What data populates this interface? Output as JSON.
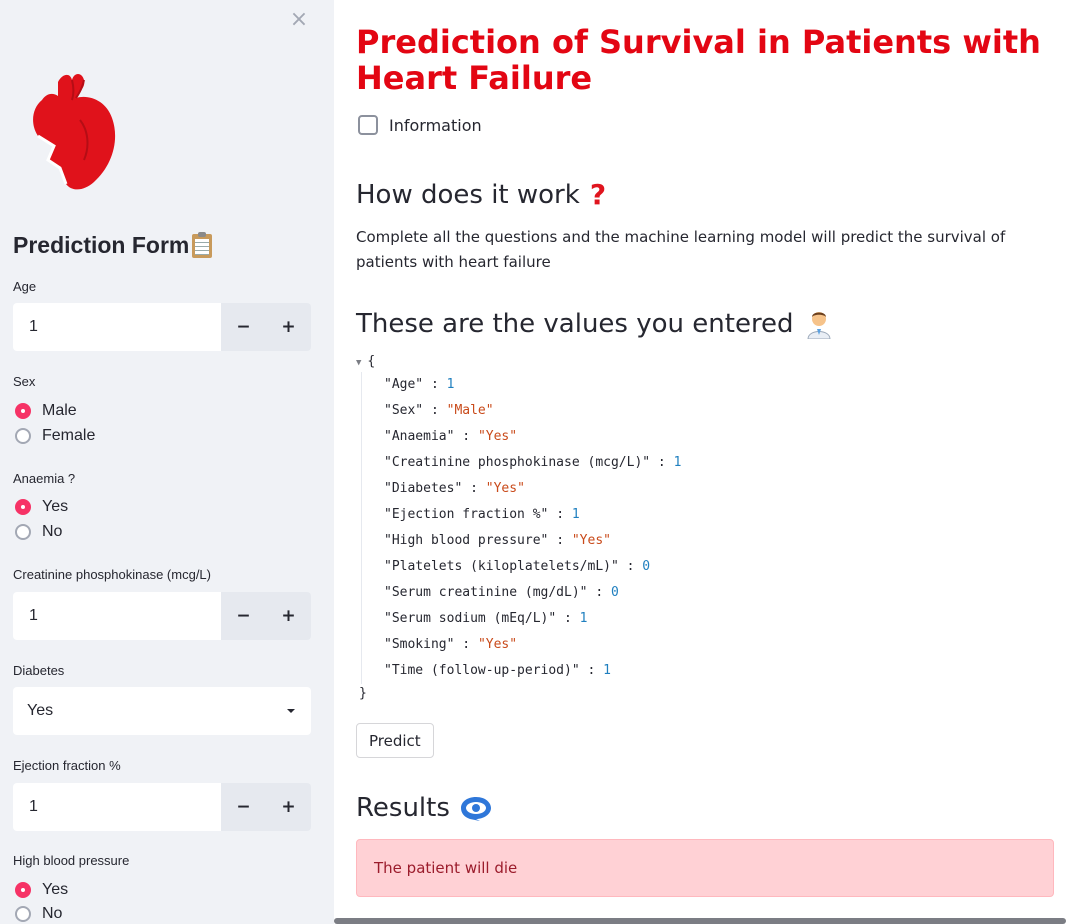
{
  "sidebar": {
    "close_glyph": "×",
    "logo_icon": "broken-heart-icon",
    "form_title": "Prediction Form",
    "age": {
      "label": "Age",
      "value": "1",
      "minus": "−",
      "plus": "+"
    },
    "sex": {
      "label": "Sex",
      "options": [
        "Male",
        "Female"
      ],
      "selected": "Male"
    },
    "anaemia": {
      "label": "Anaemia ?",
      "options": [
        "Yes",
        "No"
      ],
      "selected": "Yes"
    },
    "cpk": {
      "label": "Creatinine phosphokinase (mcg/L)",
      "value": "1",
      "minus": "−",
      "plus": "+"
    },
    "diabetes": {
      "label": "Diabetes",
      "selected": "Yes"
    },
    "ejection": {
      "label": "Ejection fraction %",
      "value": "1",
      "minus": "−",
      "plus": "+"
    },
    "hbp": {
      "label": "High blood pressure",
      "options": [
        "Yes",
        "No"
      ],
      "selected": "Yes"
    }
  },
  "main": {
    "title": "Prediction of Survival in Patients with Heart Failure",
    "info_checkbox_label": "Information",
    "how_heading": "How does it work",
    "how_text": "Complete all the questions and the machine learning model will predict the survival of patients with heart failure",
    "values_heading": "These are the values you entered",
    "json_open": "{",
    "json_close": "}",
    "entries": [
      {
        "key": "\"Age\"",
        "val": "1",
        "type": "num"
      },
      {
        "key": "\"Sex\"",
        "val": "\"Male\"",
        "type": "str"
      },
      {
        "key": "\"Anaemia\"",
        "val": "\"Yes\"",
        "type": "str"
      },
      {
        "key": "\"Creatinine phosphokinase (mcg/L)\"",
        "val": "1",
        "type": "num"
      },
      {
        "key": "\"Diabetes\"",
        "val": "\"Yes\"",
        "type": "str"
      },
      {
        "key": "\"Ejection fraction %\"",
        "val": "1",
        "type": "num"
      },
      {
        "key": "\"High blood pressure\"",
        "val": "\"Yes\"",
        "type": "str"
      },
      {
        "key": "\"Platelets (kiloplatelets/mL)\"",
        "val": "0",
        "type": "num"
      },
      {
        "key": "\"Serum creatinine (mg/dL)\"",
        "val": "0",
        "type": "num"
      },
      {
        "key": "\"Serum sodium (mEq/L)\"",
        "val": "1",
        "type": "num"
      },
      {
        "key": "\"Smoking\"",
        "val": "\"Yes\"",
        "type": "str"
      },
      {
        "key": "\"Time (follow-up-period)\"",
        "val": "1",
        "type": "num"
      }
    ],
    "predict_button": "Predict",
    "results_heading": "Results",
    "result_text": "The patient will die"
  },
  "colors": {
    "title_red": "#e30613",
    "accent": "#f63366",
    "alert_bg": "#ffd1d5",
    "alert_text": "#9b1c2c"
  }
}
